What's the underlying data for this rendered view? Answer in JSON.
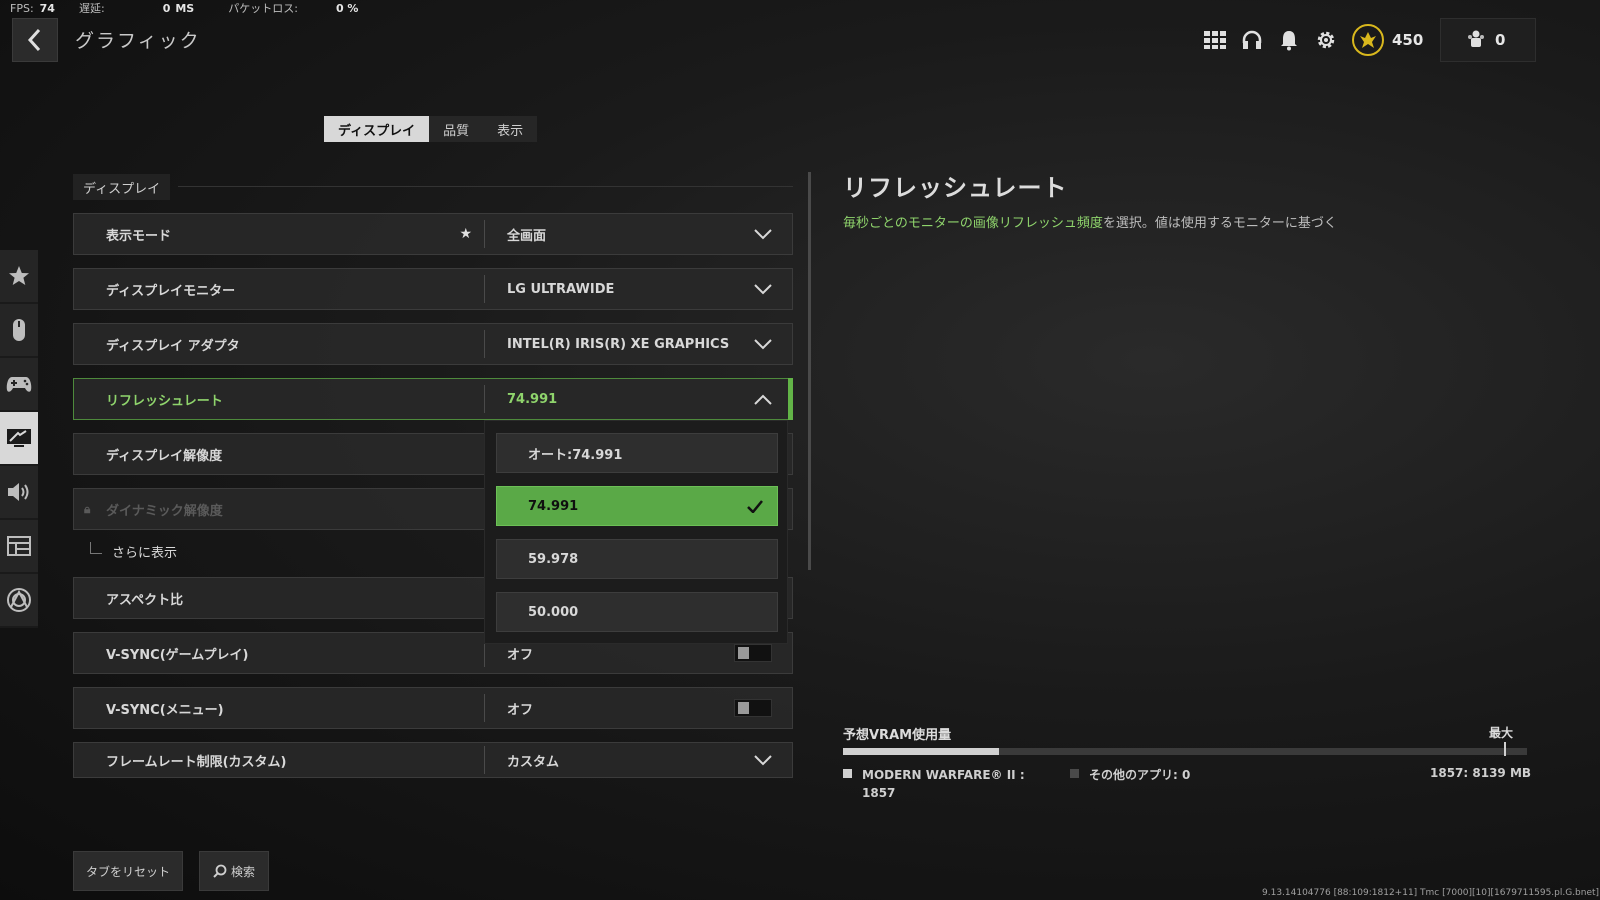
{
  "stats": {
    "fps_label": "FPS:",
    "fps_value": "74",
    "latency_label": "遅延:",
    "latency_value": "0",
    "latency_unit": "MS",
    "packet_label": "パケットロス:",
    "packet_value": "0 %"
  },
  "header": {
    "title": "グラフィック"
  },
  "topbar": {
    "cp_value": "450",
    "party_value": "0"
  },
  "tabs": [
    {
      "label": "ディスプレイ"
    },
    {
      "label": "品質"
    },
    {
      "label": "表示"
    }
  ],
  "section": {
    "title": "ディスプレイ"
  },
  "rows": [
    {
      "name": "表示モード",
      "value": "全画面"
    },
    {
      "name": "ディスプレイモニター",
      "value": "LG ULTRAWIDE"
    },
    {
      "name": "ディスプレイ アダプタ",
      "value": "INTEL(R) IRIS(R) XE GRAPHICS"
    },
    {
      "name": "リフレッシュレート",
      "value": "74.991"
    },
    {
      "name": "ディスプレイ解像度",
      "value": ""
    },
    {
      "name": "ダイナミック解像度",
      "value": ""
    },
    {
      "name": "アスペクト比",
      "value": ""
    },
    {
      "name": "V-SYNC(ゲームプレイ)",
      "value": "オフ"
    },
    {
      "name": "V-SYNC(メニュー)",
      "value": "オフ"
    },
    {
      "name": "フレームレート制限(カスタム)",
      "value": "カスタム"
    }
  ],
  "subrow": {
    "label": "さらに表示"
  },
  "dropdown": {
    "options": [
      "オート:74.991",
      "74.991",
      "59.978",
      "50.000"
    ],
    "selected": "74.991"
  },
  "info": {
    "title": "リフレッシュレート",
    "desc_highlight": "毎秒ごとのモニターの画像リフレッシュ頻度",
    "desc_rest": "を選択。値は使用するモニターに基づく"
  },
  "vram": {
    "title": "予想VRAM使用量",
    "max_label": "最大",
    "game_label": "MODERN WARFARE® II :",
    "game_value": "1857",
    "other_label": "その他のアプリ: 0",
    "total": "1857: 8139 MB",
    "used_fraction": 0.228,
    "marker_fraction": 0.966
  },
  "bottom": {
    "reset_label": "タブをリセット",
    "search_label": "検索"
  },
  "version": "9.13.14104776 [88:109:1812+11] Tmc [7000][10][1679711595.pl.G.bnet]",
  "colors": {
    "accent_green": "#62b447",
    "highlight_text": "#8fd46c",
    "cp_gold": "#d9b81d"
  },
  "sidebar_icons": [
    "star-icon",
    "mouse-icon",
    "controller-icon",
    "monitor-icon",
    "speaker-icon",
    "interface-icon",
    "network-icon"
  ]
}
